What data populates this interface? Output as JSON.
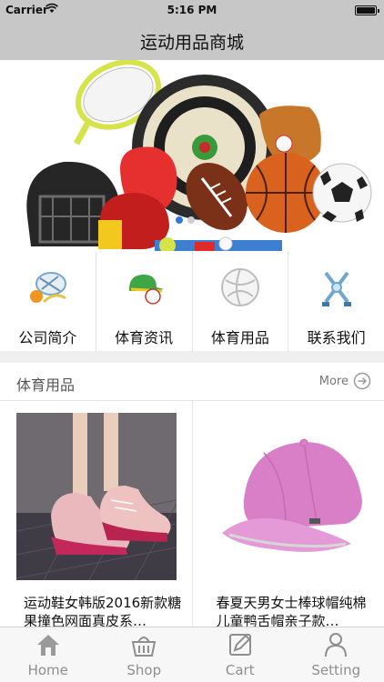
{
  "status_bar": {
    "carrier": "Carrier",
    "time": "5:16 PM"
  },
  "nav": {
    "title": "运动用品商城"
  },
  "banner": {
    "slides": 2,
    "active_slide": 1
  },
  "quick_nav": [
    {
      "label": "公司简介",
      "icon": "company-profile-icon"
    },
    {
      "label": "体育资讯",
      "icon": "sports-news-icon"
    },
    {
      "label": "体育用品",
      "icon": "sports-goods-icon"
    },
    {
      "label": "联系我们",
      "icon": "contact-us-icon"
    }
  ],
  "section": {
    "title": "体育用品",
    "more": "More"
  },
  "products": [
    {
      "name": "运动鞋女韩版2016新款糖果撞色网面真皮系…"
    },
    {
      "name": "春夏天男女士棒球帽纯棉儿童鸭舌帽亲子款…"
    }
  ],
  "tabs": [
    {
      "label": "Home",
      "icon": "home-icon"
    },
    {
      "label": "Shop",
      "icon": "shop-basket-icon"
    },
    {
      "label": "Cart",
      "icon": "cart-edit-icon"
    },
    {
      "label": "Setting",
      "icon": "user-icon"
    }
  ],
  "colors": {
    "bar_gray": "#c7c7c7",
    "dot_active": "#2a7ae2",
    "tab_inactive": "#8e8e8e"
  }
}
